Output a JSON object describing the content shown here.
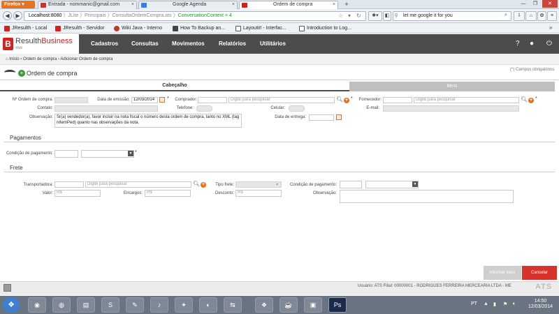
{
  "browser": {
    "firefox_label": "Firefox",
    "tabs": [
      {
        "label": "Entrada - nommanic@gmail.com",
        "color": "#c0392b"
      },
      {
        "label": "Google Agenda",
        "color": "#3b7ddd"
      },
      {
        "label": "Ordem de compra",
        "color": "#d4201f"
      }
    ],
    "url": {
      "host": "Localhost:8080",
      "path": " 〉JLite 〉Principais 〉ConsultaOrdemCompra.ats 〉",
      "context": "ConversationContext = 4"
    },
    "search_text": "let me google it for you",
    "bookmarks": [
      {
        "label": "JResulth - Local",
        "color": "#d4201f"
      },
      {
        "label": "JResulth - Servidor",
        "color": "#d4201f"
      },
      {
        "label": "Wiki Java - Interno",
        "color": "#c0392b"
      },
      {
        "label": "How To Backup an...",
        "color": "#444444"
      },
      {
        "label": "Layoutit! - Interfac...",
        "color": "#555555"
      },
      {
        "label": "Introduction to Log...",
        "color": "#555555"
      }
    ]
  },
  "app": {
    "logo_main": "Resulth",
    "logo_accent": "Business",
    "logo_sub": "Web",
    "logo_letter": "B",
    "menu": [
      "Cadastros",
      "Consultas",
      "Movimentos",
      "Relatórios",
      "Utilitários"
    ],
    "breadcrumb": "Início  ›  Ordem de compra  ›  Adicionar Ordem de compra",
    "page_title": "Ordem de compra",
    "required_note": "(*) Campos obrigatórios",
    "tab_header": "Cabeçalho",
    "tab_items": "Itens"
  },
  "header": {
    "numero_label": "Nº Ordem de compra:",
    "emissao_label": "Data de emissão:",
    "emissao_value": "12/03/2014",
    "comprador_label": "Comprador:",
    "comprador_placeholder": "Digite para pesquisar",
    "fornecedor_label": "Fornecedor:",
    "fornecedor_placeholder": "Digite para pesquisar",
    "contato_label": "Contato:",
    "telefone_label": "Telefone:",
    "celular_label": "Celular:",
    "email_label": "E-mail:",
    "observacao_label": "Observação:",
    "observacao_value": "Sr(a) vendedor(a), favor incluir na nota fiscal o número desta ordem de compra, tanto no XML (tag nItemPed) quanto nas observações da nota.",
    "entrega_label": "Data de entrega:",
    "required_mark": "*"
  },
  "pagamentos": {
    "title": "Pagamentos",
    "condicao_label": "Condição de pagamento:"
  },
  "frete": {
    "title": "Frete",
    "transportadora_label": "Transportadora:",
    "transportadora_placeholder": "Digite para pesquisar",
    "tipo_label": "Tipo frete:",
    "condicao_label": "Condição de pagamento:",
    "valor_label": "Valor:",
    "valor_placeholder": "R$",
    "encargos_label": "Encargos:",
    "encargos_placeholder": "R$",
    "desconto_label": "Desconto:",
    "desconto_placeholder": "R$",
    "observacao_label": "Observação:"
  },
  "buttons": {
    "informar_itens": "Informar itens",
    "cancelar": "Cancelar"
  },
  "footer": {
    "text": "Usuário: ATS   Filial: 00000001 - RODRIGUES FERREIRA MERCEARIA LTDA - ME",
    "ats": "ATS"
  },
  "taskbar": {
    "lang": "PT",
    "time": "14:50",
    "date": "12/03/2014",
    "apps": [
      "◉",
      "◍",
      "▤",
      "S",
      "✎",
      "♪",
      "✦",
      "◐",
      "⇆",
      "❖",
      "☕",
      "▣",
      "Ps"
    ]
  },
  "colors": {
    "brand_red": "#d4201f",
    "header_dark": "#4c4c4c",
    "accent_orange": "#e8731f"
  }
}
